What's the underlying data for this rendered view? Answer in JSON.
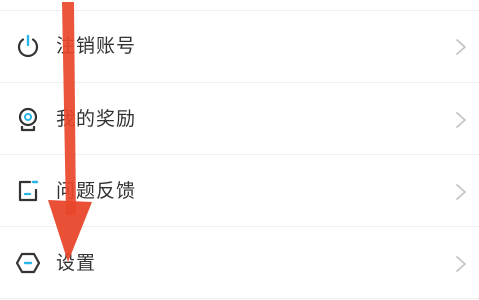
{
  "menu": {
    "items": [
      {
        "label": "注销账号",
        "icon": "power-icon"
      },
      {
        "label": "我的奖励",
        "icon": "badge-icon"
      },
      {
        "label": "问题反馈",
        "icon": "feedback-icon"
      },
      {
        "label": "设置",
        "icon": "settings-hexagon-icon"
      }
    ]
  },
  "colors": {
    "icon_dark": "#333333",
    "icon_accent": "#29b6e8",
    "chevron": "#c4c4c4",
    "divider": "#efefef",
    "arrow": "#e9472b"
  },
  "annotation": {
    "icon": "red-down-arrow",
    "points_to": "设置"
  }
}
